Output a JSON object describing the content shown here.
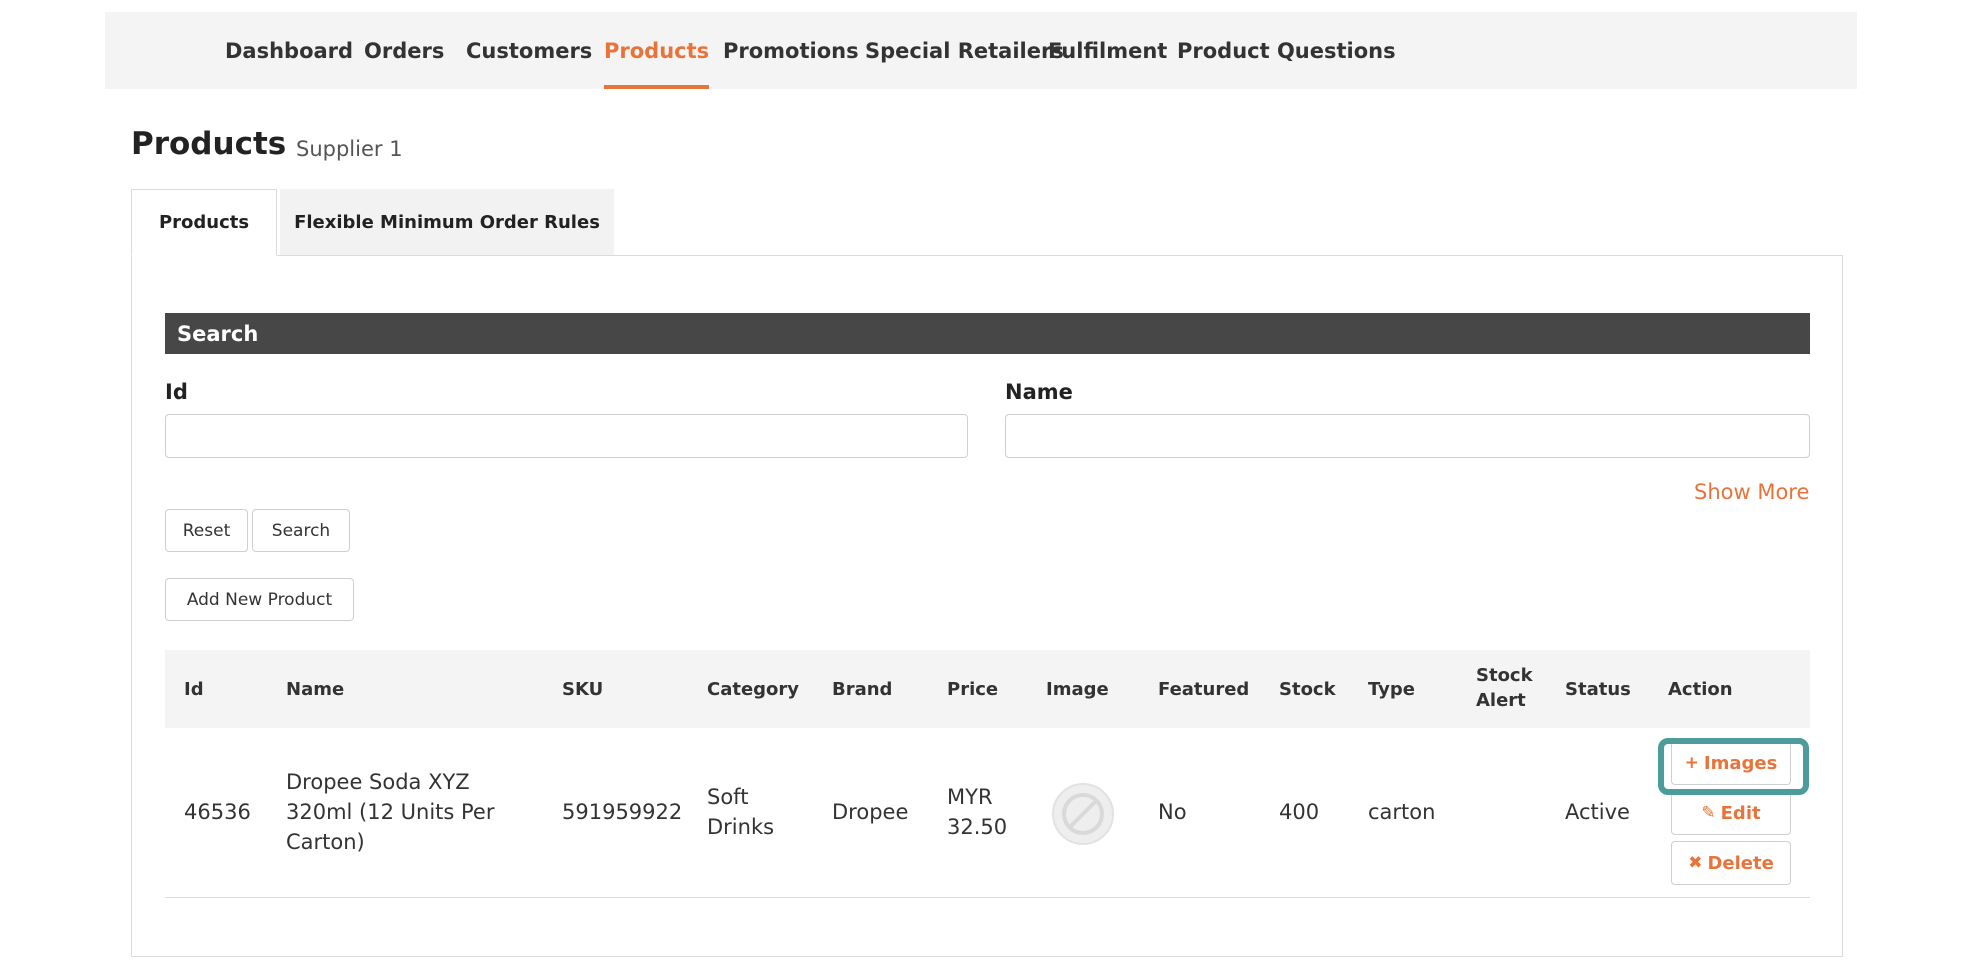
{
  "nav": {
    "items": [
      {
        "label": "Dashboard"
      },
      {
        "label": "Orders"
      },
      {
        "label": "Customers"
      },
      {
        "label": "Products"
      },
      {
        "label": "Promotions"
      },
      {
        "label": "Special Retailers"
      },
      {
        "label": "Fulfilment"
      },
      {
        "label": "Product Questions"
      }
    ],
    "active": "Products"
  },
  "page": {
    "title": "Products",
    "subtitle": "Supplier 1"
  },
  "tabs": [
    {
      "label": "Products",
      "active": true
    },
    {
      "label": "Flexible Minimum Order Rules",
      "active": false
    }
  ],
  "search": {
    "header": "Search",
    "fields": {
      "id": {
        "label": "Id",
        "value": "",
        "placeholder": ""
      },
      "name": {
        "label": "Name",
        "value": "",
        "placeholder": ""
      }
    },
    "show_more": "Show More",
    "reset_label": "Reset",
    "search_label": "Search"
  },
  "add_product_label": "Add New Product",
  "table": {
    "columns": [
      "Id",
      "Name",
      "SKU",
      "Category",
      "Brand",
      "Price",
      "Image",
      "Featured",
      "Stock",
      "Type",
      "Stock\nAlert",
      "Status",
      "Action"
    ],
    "rows": [
      {
        "id": "46536",
        "name": "Dropee Soda XYZ 320ml (12 Units Per Carton)",
        "sku": "591959922",
        "category": "Soft Drinks",
        "brand": "Dropee",
        "price": "MYR 32.50",
        "image_alt": "No Image available",
        "featured": "No",
        "stock": "400",
        "type": "carton",
        "stock_alert": "",
        "status": "Active",
        "actions": {
          "images": "Images",
          "edit": "Edit",
          "delete": "Delete"
        }
      }
    ]
  },
  "icons": {
    "images": "plus-icon",
    "edit": "pencil-icon",
    "delete": "times-icon",
    "no_image": "no-image-icon"
  },
  "colors": {
    "accent": "#e8743b",
    "search_header_bg": "#474747",
    "highlight": "#4b9c9a"
  }
}
